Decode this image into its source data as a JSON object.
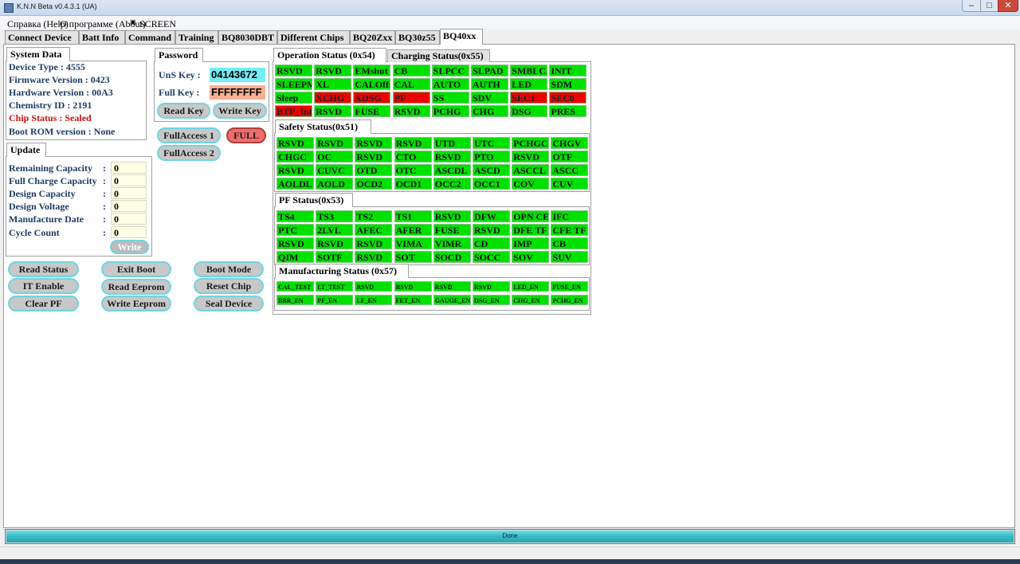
{
  "window": {
    "title": "K.N.N Beta v0.4.3.1 (UA)",
    "min": "–",
    "max": "□",
    "close": "✕"
  },
  "menu": [
    "Справка (Help)",
    "О программе (About)",
    "SCREEN"
  ],
  "tabs": [
    "Connect Device",
    "Batt Info",
    "Command",
    "Training",
    "BQ8030DBT",
    "Different Chips",
    "BQ20Zxx",
    "BQ30z55",
    "BQ40xx"
  ],
  "system_data": {
    "title": "System Data",
    "lines": [
      "Device Type       : 4555",
      "Firmware Version : 0423",
      "Hardware Version : 00A3",
      "Chemistry ID : 2191",
      "Chip Status : Sealed",
      "Boot ROM version : None"
    ]
  },
  "update": {
    "title": "Update",
    "rows": [
      {
        "label": "Remaining Capacity",
        "value": "0"
      },
      {
        "label": "Full Charge Capacity",
        "value": "0"
      },
      {
        "label": "Design Capacity",
        "value": "0"
      },
      {
        "label": "Design Voltage",
        "value": "0"
      },
      {
        "label": "Manufacture Date",
        "value": "0"
      },
      {
        "label": "Cycle Count",
        "value": "0"
      }
    ],
    "colon": ":",
    "write": "Write"
  },
  "password": {
    "title": "Password",
    "uns_label": "UnS Key  :",
    "uns_value": "04143672",
    "full_label": "Full Key  :",
    "full_value": "FFFFFFFF",
    "read_key": "Read Key",
    "write_key": "Write Key",
    "full_access_1": "FullAccess 1",
    "full_access_2": "FullAccess 2",
    "full_badge": "FULL"
  },
  "buttons": [
    "Read Status",
    "Exit Boot",
    "Boot Mode",
    "IT Enable",
    "Read Eeprom",
    "Reset Chip",
    "Clear PF",
    "Write Eeprom",
    "Seal Device"
  ],
  "operation": {
    "tabs": [
      "Operation Status (0x54)",
      "Charging Status(0x55)"
    ],
    "cells": [
      "RSVD",
      "RSVD",
      "EMshut",
      "CB",
      "SLPCC",
      "SLPAD",
      "SMBLCAL",
      "INIT",
      "SLEEPM",
      "XL",
      "CALOffset",
      "CAL",
      "AUTO",
      "AUTH",
      "LED",
      "SDM",
      "Sleep",
      "XCHG",
      "XDSG",
      "PF",
      "SS",
      "SDV",
      "SEC1",
      "SEC0",
      "BTP_Int",
      "RSVD",
      "FUSE",
      "RSVD",
      "PCHG",
      "CHG",
      "DSG",
      "PRES"
    ],
    "red": [
      17,
      18,
      19,
      22,
      23,
      24
    ]
  },
  "safety": {
    "title": "Safety Status(0x51)",
    "cells": [
      "RSVD",
      "RSVD",
      "RSVD",
      "RSVD",
      "UTD",
      "UTC",
      "PCHGC",
      "CHGV",
      "CHGC",
      "OC",
      "RSVD",
      "CTO",
      "RSVD",
      "PTO",
      "RSVD",
      "OTF",
      "RSVD",
      "CUVC",
      "OTD",
      "OTC",
      "ASCDL",
      "ASCD",
      "ASCCL",
      "ASCC",
      "AOLDL",
      "AOLD",
      "OCD2",
      "OCD1",
      "OCC2",
      "OCC1",
      "COV",
      "CUV"
    ]
  },
  "pf": {
    "title": "PF Status(0x53)",
    "cells": [
      "TS4",
      "TS3",
      "TS2",
      "TS1",
      "RSVD",
      "DFW",
      "OPN CELL",
      "IFC",
      "PTC",
      "2LVL",
      "AFEC",
      "AFER",
      "FUSE",
      "RSVD",
      "DFE TF",
      "CFE TF",
      "RSVD",
      "RSVD",
      "RSVD",
      "VIMA",
      "VIMR",
      "CD",
      "IMP",
      "CB",
      "QIM",
      "SOTF",
      "RSVD",
      "SOT",
      "SOCD",
      "SOCC",
      "SOV",
      "SUV"
    ]
  },
  "manufacturing": {
    "title": "Manufacturing Status (0x57)",
    "cells": [
      "CAL_TEST",
      "LT_TEST",
      "RSVD",
      "RSVD",
      "RSVD",
      "RSVD",
      "LED_EN",
      "FUSE_EN",
      "BBR_EN",
      "PF_EN",
      "LF_EN",
      "FET_EN",
      "GAUGE_EN",
      "DSG_EN",
      "CHG_EN",
      "PCHG_EN"
    ]
  },
  "progress": {
    "text": "Done",
    "fraction": 1.0
  },
  "colors": {
    "ok": "#00e100",
    "alarm": "#ee0000",
    "accent": "#71d3df",
    "label": "#1e3c64"
  }
}
